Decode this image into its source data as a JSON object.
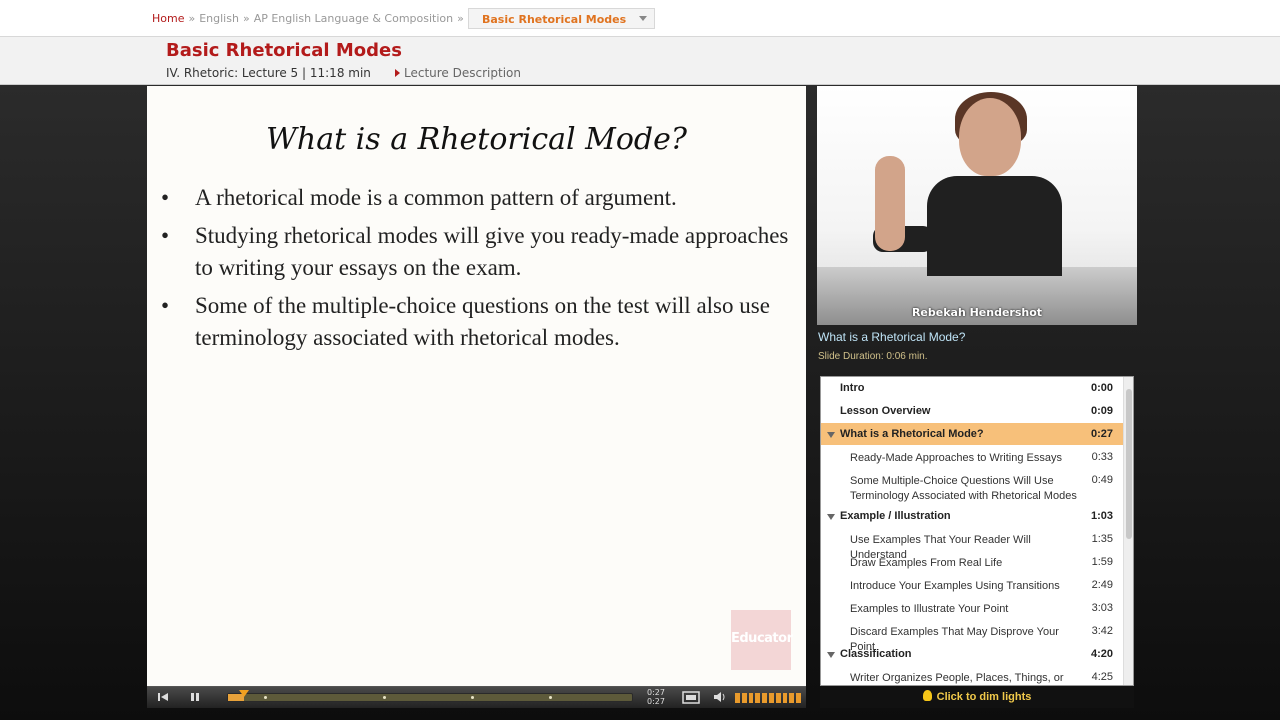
{
  "breadcrumb": {
    "home": "Home",
    "sep": "»",
    "subject": "English",
    "course": "AP English Language & Composition",
    "current": "Basic Rhetorical Modes"
  },
  "lecture": {
    "title": "Basic Rhetorical Modes",
    "meta": "IV. Rhetoric: Lecture 5 | 11:18 min",
    "description_link": "Lecture Description"
  },
  "slide": {
    "title": "What is a Rhetorical Mode?",
    "bullet_glyph": "•",
    "bullets": [
      "A rhetorical mode is a common pattern of argument.",
      "Studying rhetorical modes will give you ready-made approaches to writing your essays on the exam.",
      "Some of the multiple-choice questions on the test will also use terminology associated with rhetorical modes."
    ],
    "watermark": "Educator"
  },
  "player": {
    "elapsed": "0:27",
    "elapsed2": "0:27",
    "progress": 0.04,
    "volume_level": 1.0
  },
  "video": {
    "presenter": "Rebekah Hendershot",
    "current_slide": "What is a Rhetorical Mode?",
    "slide_duration": "Slide Duration: 0:06 min."
  },
  "outline": [
    {
      "type": "section",
      "label": "Intro",
      "time": "0:00"
    },
    {
      "type": "section",
      "label": "Lesson Overview",
      "time": "0:09"
    },
    {
      "type": "section",
      "label": "What is a Rhetorical Mode?",
      "time": "0:27",
      "active": true,
      "expanded": true
    },
    {
      "type": "sub",
      "label": "Ready-Made Approaches to Writing Essays",
      "time": "0:33"
    },
    {
      "type": "sub",
      "label": "Some Multiple-Choice Questions Will Use Terminology Associated with Rhetorical Modes",
      "time": "0:49"
    },
    {
      "type": "section",
      "label": "Example / Illustration",
      "time": "1:03",
      "expanded": true
    },
    {
      "type": "sub",
      "label": "Use Examples That Your Reader Will Understand",
      "time": "1:35"
    },
    {
      "type": "sub",
      "label": "Draw Examples From Real Life",
      "time": "1:59"
    },
    {
      "type": "sub",
      "label": "Introduce Your Examples Using Transitions",
      "time": "2:49"
    },
    {
      "type": "sub",
      "label": "Examples to Illustrate Your Point",
      "time": "3:03"
    },
    {
      "type": "sub",
      "label": "Discard Examples That May Disprove Your Point",
      "time": "3:42"
    },
    {
      "type": "section",
      "label": "Classification",
      "time": "4:20",
      "expanded": true
    },
    {
      "type": "sub",
      "label": "Writer Organizes People, Places, Things, or",
      "time": "4:25"
    }
  ],
  "dim_lights": "Click to dim lights",
  "colors": {
    "accent_red": "#b31b1b",
    "accent_orange": "#e0731f",
    "active_row": "#f7c07a"
  }
}
